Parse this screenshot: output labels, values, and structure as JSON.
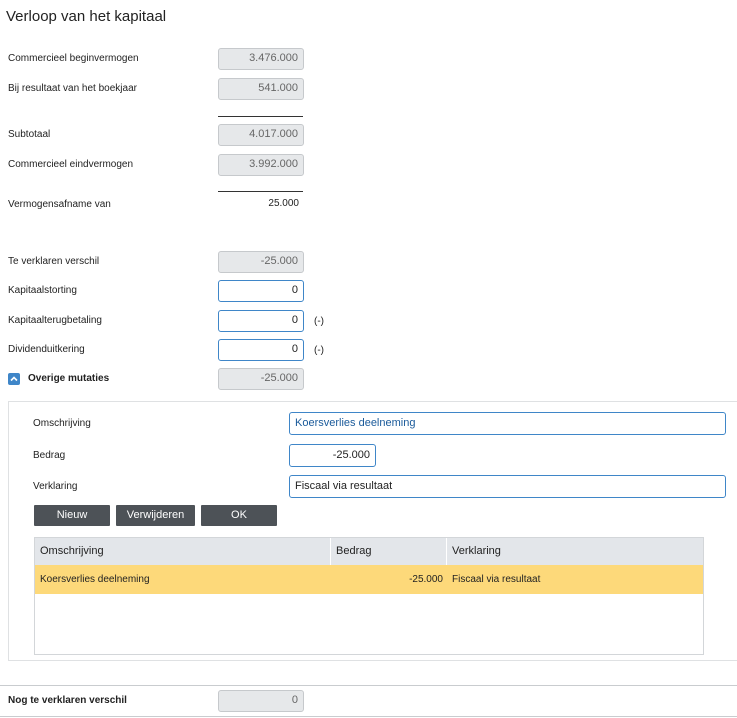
{
  "title": "Verloop van het kapitaal",
  "rows": {
    "begin": {
      "label": "Commercieel beginvermogen",
      "value": "3.476.000"
    },
    "resultaat": {
      "label": "Bij resultaat van het boekjaar",
      "value": "541.000"
    },
    "subtotaal": {
      "label": "Subtotaal",
      "value": "4.017.000"
    },
    "eind": {
      "label": "Commercieel eindvermogen",
      "value": "3.992.000"
    },
    "afname": {
      "label": "Vermogensafname van",
      "value": "25.000"
    },
    "verschil": {
      "label": "Te verklaren verschil",
      "value": "-25.000"
    },
    "storting": {
      "label": "Kapitaalstorting",
      "value": "0"
    },
    "terugbetaling": {
      "label": "Kapitaalterugbetaling",
      "value": "0",
      "suffix": "(-)"
    },
    "dividend": {
      "label": "Dividenduitkering",
      "value": "0",
      "suffix": "(-)"
    },
    "overige": {
      "label": "Overige mutaties",
      "value": "-25.000"
    }
  },
  "detail": {
    "omschrijving": {
      "label": "Omschrijving",
      "value": "Koersverlies deelneming"
    },
    "bedrag": {
      "label": "Bedrag",
      "value": "-25.000"
    },
    "verklaring": {
      "label": "Verklaring",
      "value": "Fiscaal via resultaat"
    },
    "buttons": {
      "nieuw": "Nieuw",
      "verwijderen": "Verwijderen",
      "ok": "OK"
    }
  },
  "grid": {
    "headers": {
      "omschrijving": "Omschrijving",
      "bedrag": "Bedrag",
      "verklaring": "Verklaring"
    },
    "rows": [
      {
        "omschrijving": "Koersverlies deelneming",
        "bedrag": "-25.000",
        "verklaring": "Fiscaal via resultaat"
      }
    ]
  },
  "footer": {
    "label": "Nog te verklaren verschil",
    "value": "0"
  },
  "colors": {
    "accent": "#3f86c8",
    "selected_row": "#fdd97a",
    "button": "#4d5257"
  }
}
